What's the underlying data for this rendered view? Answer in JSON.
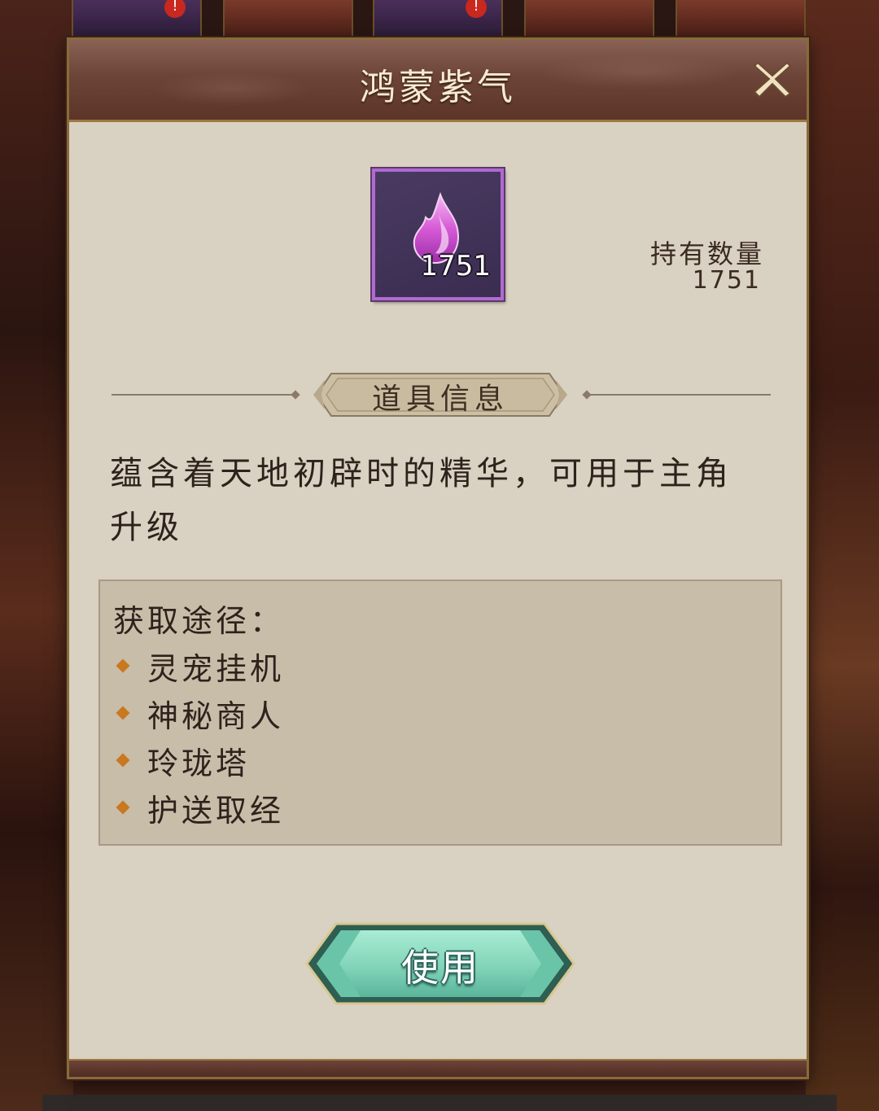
{
  "dialog": {
    "title": "鸿蒙紫气",
    "close_icon": "close-x-icon"
  },
  "item": {
    "icon": "purple-flame-crystal-icon",
    "count": "1751",
    "rarity_color": "#b06ad0"
  },
  "ownership": {
    "label": "持有数量",
    "value": "1751"
  },
  "section": {
    "title": "道具信息"
  },
  "description": {
    "line1": "蕴含着天地初辟时的精华，可用于主角",
    "line2": "升级"
  },
  "sources": {
    "title": "获取途径：",
    "items": [
      "灵宠挂机",
      "神秘商人",
      "玲珑塔",
      "护送取经"
    ]
  },
  "actions": {
    "use_label": "使用",
    "button_color": "#8fd8c0"
  }
}
